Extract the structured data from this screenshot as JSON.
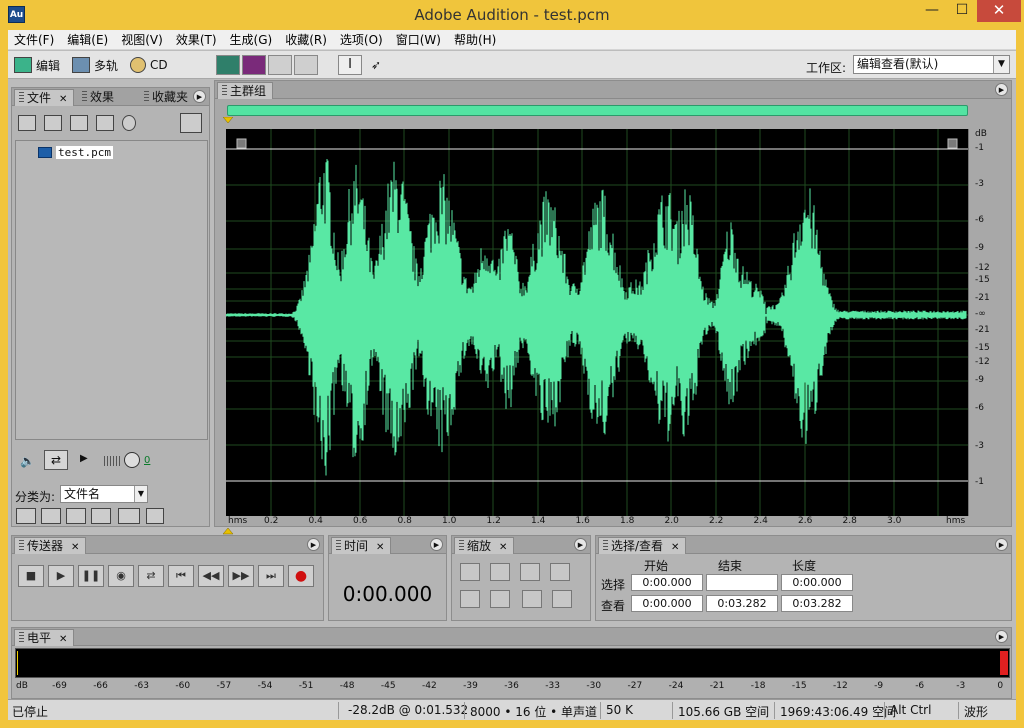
{
  "window": {
    "title": "Adobe Audition - test.pcm",
    "logo": "Au",
    "minimize": "—",
    "maximize": "☐",
    "close": "✕"
  },
  "menu": [
    "文件(F)",
    "编辑(E)",
    "视图(V)",
    "效果(T)",
    "生成(G)",
    "收藏(R)",
    "选项(O)",
    "窗口(W)",
    "帮助(H)"
  ],
  "toolbar": {
    "edit_label": "编辑",
    "multitrack_label": "多轨",
    "cd_label": "CD",
    "workspace_label": "工作区:",
    "workspace_value": "编辑查看(默认)"
  },
  "files_panel": {
    "tabs": [
      "文件",
      "效果",
      "收藏夹"
    ],
    "file_name": "test.pcm",
    "volume_value": "0",
    "sort_label": "分类为:",
    "sort_value": "文件名"
  },
  "editor": {
    "tab": "主群组",
    "time_axis_unit": "hms",
    "time_ticks": [
      "0.2",
      "0.4",
      "0.6",
      "0.8",
      "1.0",
      "1.2",
      "1.4",
      "1.6",
      "1.8",
      "2.0",
      "2.2",
      "2.4",
      "2.6",
      "2.8",
      "3.0"
    ],
    "db_unit": "dB",
    "db_ticks": [
      "-1",
      "-3",
      "-6",
      "-9",
      "-12",
      "-15",
      "-21",
      "-∞",
      "-21",
      "-15",
      "-12",
      "-9",
      "-6",
      "-3",
      "-1"
    ],
    "wave_color": "#59e8a4"
  },
  "transport_panel": {
    "tab": "传送器"
  },
  "time_panel": {
    "tab": "时间",
    "display": "0:00.000"
  },
  "zoom_panel": {
    "tab": "缩放"
  },
  "selection_panel": {
    "tab": "选择/查看",
    "headers": [
      "开始",
      "结束",
      "长度"
    ],
    "rows": [
      {
        "label": "选择",
        "start": "0:00.000",
        "end": "",
        "length": "0:00.000"
      },
      {
        "label": "查看",
        "start": "0:00.000",
        "end": "0:03.282",
        "length": "0:03.282"
      }
    ]
  },
  "level_panel": {
    "tab": "电平",
    "scale": [
      "dB",
      "-69",
      "-66",
      "-63",
      "-60",
      "-57",
      "-54",
      "-51",
      "-48",
      "-45",
      "-42",
      "-39",
      "-36",
      "-33",
      "-30",
      "-27",
      "-24",
      "-21",
      "-18",
      "-15",
      "-12",
      "-9",
      "-6",
      "-3",
      "0"
    ]
  },
  "status": {
    "state": "已停止",
    "cursor": "-28.2dB @  0:01.532",
    "format": "8000 • 16 位 • 单声道",
    "size": "50 K",
    "disk": "105.66 GB 空间",
    "time_free": "1969:43:06.49 空间",
    "keys": "Alt Ctrl",
    "view": "波形"
  }
}
